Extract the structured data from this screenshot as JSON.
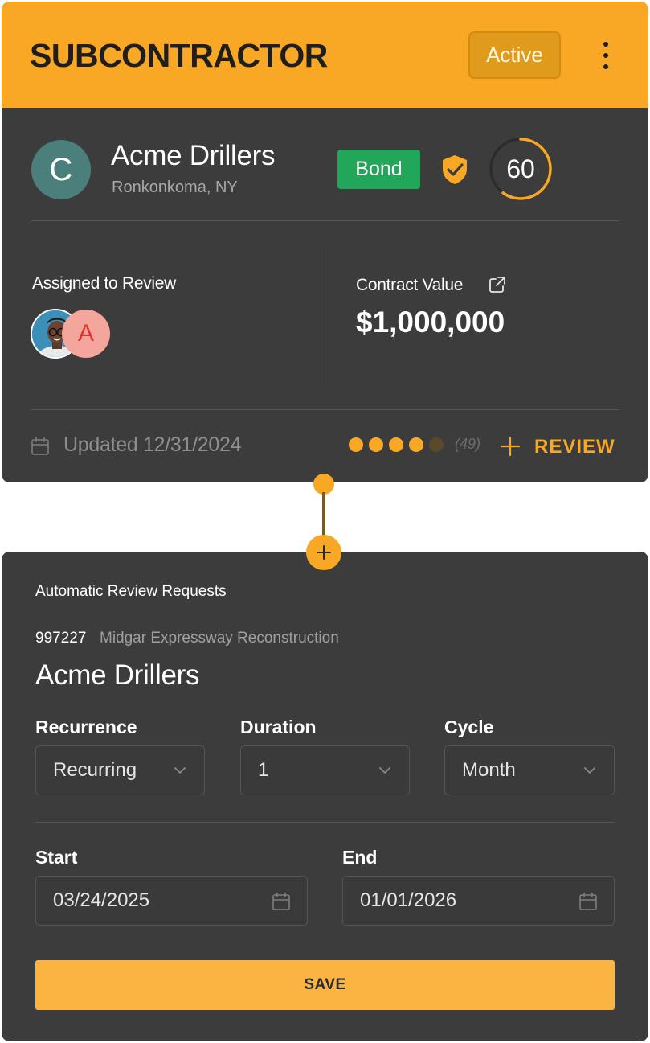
{
  "header": {
    "title": "SUBCONTRACTOR",
    "status": "Active"
  },
  "company": {
    "avatar_letter": "C",
    "name": "Acme Drillers",
    "location": "Ronkonkoma, NY",
    "badge": "Bond",
    "score": "60",
    "score_fraction": 0.6
  },
  "assigned": {
    "label": "Assigned to Review",
    "second_avatar_letter": "A"
  },
  "contract": {
    "label": "Contract Value",
    "value": "$1,000,000"
  },
  "footer": {
    "updated": "Updated 12/31/2024",
    "rating": 4,
    "rating_max": 5,
    "rating_count": "(49)",
    "review_label": "REVIEW"
  },
  "auto_review": {
    "title": "Automatic Review Requests",
    "project_id": "997227",
    "project_name": "Midgar Expressway Reconstruction",
    "company_name": "Acme Drillers",
    "recurrence": {
      "label": "Recurrence",
      "value": "Recurring"
    },
    "duration": {
      "label": "Duration",
      "value": "1"
    },
    "cycle": {
      "label": "Cycle",
      "value": "Month"
    },
    "start": {
      "label": "Start",
      "value": "03/24/2025"
    },
    "end": {
      "label": "End",
      "value": "01/01/2026"
    },
    "save_label": "SAVE"
  },
  "colors": {
    "accent": "#f9a825",
    "card_bg": "#3c3c3c",
    "bond_green": "#22a65a",
    "avatar_c": "#4b7f7c",
    "avatar_a": "#f4a59c"
  }
}
